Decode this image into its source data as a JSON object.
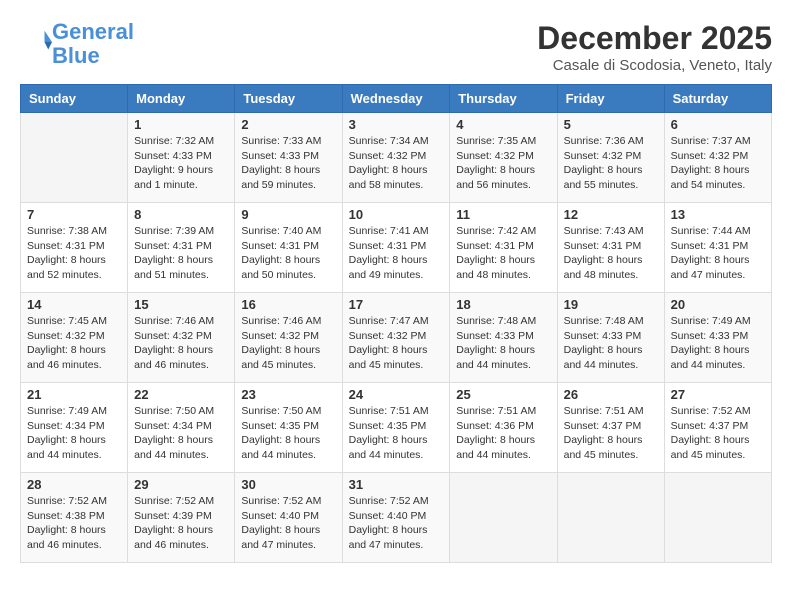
{
  "header": {
    "logo_line1": "General",
    "logo_line2": "Blue",
    "month_title": "December 2025",
    "location": "Casale di Scodosia, Veneto, Italy"
  },
  "days_of_week": [
    "Sunday",
    "Monday",
    "Tuesday",
    "Wednesday",
    "Thursday",
    "Friday",
    "Saturday"
  ],
  "weeks": [
    [
      {
        "day": "",
        "info": ""
      },
      {
        "day": "1",
        "info": "Sunrise: 7:32 AM\nSunset: 4:33 PM\nDaylight: 9 hours\nand 1 minute."
      },
      {
        "day": "2",
        "info": "Sunrise: 7:33 AM\nSunset: 4:33 PM\nDaylight: 8 hours\nand 59 minutes."
      },
      {
        "day": "3",
        "info": "Sunrise: 7:34 AM\nSunset: 4:32 PM\nDaylight: 8 hours\nand 58 minutes."
      },
      {
        "day": "4",
        "info": "Sunrise: 7:35 AM\nSunset: 4:32 PM\nDaylight: 8 hours\nand 56 minutes."
      },
      {
        "day": "5",
        "info": "Sunrise: 7:36 AM\nSunset: 4:32 PM\nDaylight: 8 hours\nand 55 minutes."
      },
      {
        "day": "6",
        "info": "Sunrise: 7:37 AM\nSunset: 4:32 PM\nDaylight: 8 hours\nand 54 minutes."
      }
    ],
    [
      {
        "day": "7",
        "info": "Sunrise: 7:38 AM\nSunset: 4:31 PM\nDaylight: 8 hours\nand 52 minutes."
      },
      {
        "day": "8",
        "info": "Sunrise: 7:39 AM\nSunset: 4:31 PM\nDaylight: 8 hours\nand 51 minutes."
      },
      {
        "day": "9",
        "info": "Sunrise: 7:40 AM\nSunset: 4:31 PM\nDaylight: 8 hours\nand 50 minutes."
      },
      {
        "day": "10",
        "info": "Sunrise: 7:41 AM\nSunset: 4:31 PM\nDaylight: 8 hours\nand 49 minutes."
      },
      {
        "day": "11",
        "info": "Sunrise: 7:42 AM\nSunset: 4:31 PM\nDaylight: 8 hours\nand 48 minutes."
      },
      {
        "day": "12",
        "info": "Sunrise: 7:43 AM\nSunset: 4:31 PM\nDaylight: 8 hours\nand 48 minutes."
      },
      {
        "day": "13",
        "info": "Sunrise: 7:44 AM\nSunset: 4:31 PM\nDaylight: 8 hours\nand 47 minutes."
      }
    ],
    [
      {
        "day": "14",
        "info": "Sunrise: 7:45 AM\nSunset: 4:32 PM\nDaylight: 8 hours\nand 46 minutes."
      },
      {
        "day": "15",
        "info": "Sunrise: 7:46 AM\nSunset: 4:32 PM\nDaylight: 8 hours\nand 46 minutes."
      },
      {
        "day": "16",
        "info": "Sunrise: 7:46 AM\nSunset: 4:32 PM\nDaylight: 8 hours\nand 45 minutes."
      },
      {
        "day": "17",
        "info": "Sunrise: 7:47 AM\nSunset: 4:32 PM\nDaylight: 8 hours\nand 45 minutes."
      },
      {
        "day": "18",
        "info": "Sunrise: 7:48 AM\nSunset: 4:33 PM\nDaylight: 8 hours\nand 44 minutes."
      },
      {
        "day": "19",
        "info": "Sunrise: 7:48 AM\nSunset: 4:33 PM\nDaylight: 8 hours\nand 44 minutes."
      },
      {
        "day": "20",
        "info": "Sunrise: 7:49 AM\nSunset: 4:33 PM\nDaylight: 8 hours\nand 44 minutes."
      }
    ],
    [
      {
        "day": "21",
        "info": "Sunrise: 7:49 AM\nSunset: 4:34 PM\nDaylight: 8 hours\nand 44 minutes."
      },
      {
        "day": "22",
        "info": "Sunrise: 7:50 AM\nSunset: 4:34 PM\nDaylight: 8 hours\nand 44 minutes."
      },
      {
        "day": "23",
        "info": "Sunrise: 7:50 AM\nSunset: 4:35 PM\nDaylight: 8 hours\nand 44 minutes."
      },
      {
        "day": "24",
        "info": "Sunrise: 7:51 AM\nSunset: 4:35 PM\nDaylight: 8 hours\nand 44 minutes."
      },
      {
        "day": "25",
        "info": "Sunrise: 7:51 AM\nSunset: 4:36 PM\nDaylight: 8 hours\nand 44 minutes."
      },
      {
        "day": "26",
        "info": "Sunrise: 7:51 AM\nSunset: 4:37 PM\nDaylight: 8 hours\nand 45 minutes."
      },
      {
        "day": "27",
        "info": "Sunrise: 7:52 AM\nSunset: 4:37 PM\nDaylight: 8 hours\nand 45 minutes."
      }
    ],
    [
      {
        "day": "28",
        "info": "Sunrise: 7:52 AM\nSunset: 4:38 PM\nDaylight: 8 hours\nand 46 minutes."
      },
      {
        "day": "29",
        "info": "Sunrise: 7:52 AM\nSunset: 4:39 PM\nDaylight: 8 hours\nand 46 minutes."
      },
      {
        "day": "30",
        "info": "Sunrise: 7:52 AM\nSunset: 4:40 PM\nDaylight: 8 hours\nand 47 minutes."
      },
      {
        "day": "31",
        "info": "Sunrise: 7:52 AM\nSunset: 4:40 PM\nDaylight: 8 hours\nand 47 minutes."
      },
      {
        "day": "",
        "info": ""
      },
      {
        "day": "",
        "info": ""
      },
      {
        "day": "",
        "info": ""
      }
    ]
  ]
}
